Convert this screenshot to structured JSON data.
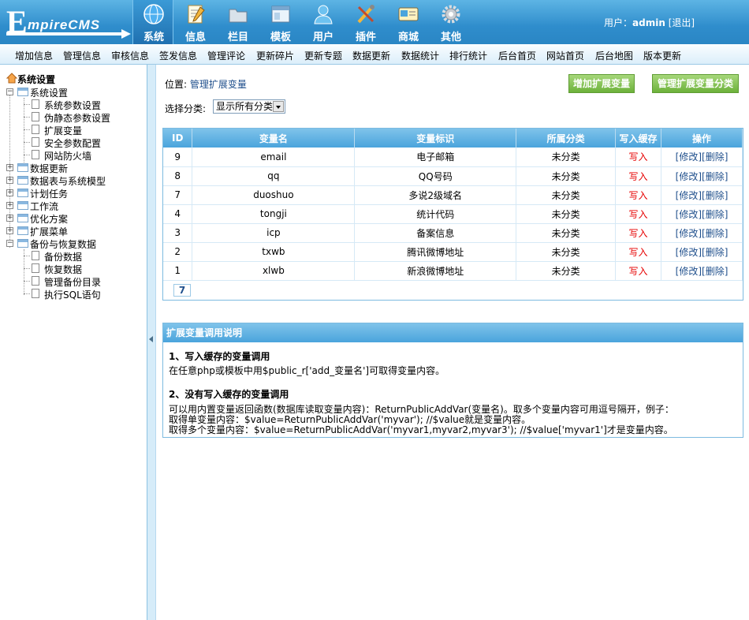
{
  "logo": {
    "big": "E",
    "small": "mpireCMS"
  },
  "main_tabs": [
    {
      "label": "系统",
      "icon": "globe-icon"
    },
    {
      "label": "信息",
      "icon": "notepad-icon"
    },
    {
      "label": "栏目",
      "icon": "folder-icon"
    },
    {
      "label": "模板",
      "icon": "window-icon"
    },
    {
      "label": "用户",
      "icon": "user-icon"
    },
    {
      "label": "插件",
      "icon": "tools-icon"
    },
    {
      "label": "商城",
      "icon": "card-icon"
    },
    {
      "label": "其他",
      "icon": "gear-icon"
    }
  ],
  "user": {
    "prefix": "用户：",
    "name": "admin",
    "logout": "[退出]"
  },
  "subnav": [
    "增加信息",
    "管理信息",
    "审核信息",
    "签发信息",
    "管理评论",
    "更新碎片",
    "更新专题",
    "数据更新",
    "数据统计",
    "排行统计",
    "后台首页",
    "网站首页",
    "后台地图",
    "版本更新"
  ],
  "sidebar": {
    "root": "系统设置",
    "group1": "系统设置",
    "group1_items": [
      "系统参数设置",
      "伪静态参数设置",
      "扩展变量",
      "安全参数配置",
      "网站防火墙"
    ],
    "groups": [
      "数据更新",
      "数据表与系统模型",
      "计划任务",
      "工作流",
      "优化方案",
      "扩展菜单"
    ],
    "group_backup": "备份与恢复数据",
    "backup_items": [
      "备份数据",
      "恢复数据",
      "管理备份目录",
      "执行SQL语句"
    ]
  },
  "location": {
    "prefix": "位置: ",
    "link": "管理扩展变量"
  },
  "buttons": {
    "add": "增加扩展变量",
    "manage": "管理扩展变量分类"
  },
  "filter": {
    "label": "选择分类:",
    "selected": "显示所有分类"
  },
  "table": {
    "headers": [
      "ID",
      "变量名",
      "变量标识",
      "所属分类",
      "写入缓存",
      "操作"
    ],
    "rows": [
      {
        "id": "9",
        "name": "email",
        "label": "电子邮箱",
        "cat": "未分类",
        "cache": "写入",
        "edit": "[修改]",
        "del": "[删除]"
      },
      {
        "id": "8",
        "name": "qq",
        "label": "QQ号码",
        "cat": "未分类",
        "cache": "写入",
        "edit": "[修改]",
        "del": "[删除]"
      },
      {
        "id": "7",
        "name": "duoshuo",
        "label": "多说2级域名",
        "cat": "未分类",
        "cache": "写入",
        "edit": "[修改]",
        "del": "[删除]"
      },
      {
        "id": "4",
        "name": "tongji",
        "label": "统计代码",
        "cat": "未分类",
        "cache": "写入",
        "edit": "[修改]",
        "del": "[删除]"
      },
      {
        "id": "3",
        "name": "icp",
        "label": "备案信息",
        "cat": "未分类",
        "cache": "写入",
        "edit": "[修改]",
        "del": "[删除]"
      },
      {
        "id": "2",
        "name": "txwb",
        "label": "腾讯微博地址",
        "cat": "未分类",
        "cache": "写入",
        "edit": "[修改]",
        "del": "[删除]"
      },
      {
        "id": "1",
        "name": "xlwb",
        "label": "新浪微博地址",
        "cat": "未分类",
        "cache": "写入",
        "edit": "[修改]",
        "del": "[删除]"
      }
    ],
    "pager": "7"
  },
  "help": {
    "title": "扩展变量调用说明",
    "h1": "1、写入缓存的变量调用",
    "p1": "在任意php或模板中用$public_r['add_变量名']可取得变量内容。",
    "h2": "2、没有写入缓存的变量调用",
    "p2a": "可以用内置变量返回函数(数据库读取变量内容)：ReturnPublicAddVar(变量名)。取多个变量内容可用逗号隔开，例子：",
    "p2b": "取得单变量内容：$value=ReturnPublicAddVar('myvar'); //$value就是变量内容。",
    "p2c": "取得多个变量内容：$value=ReturnPublicAddVar('myvar1,myvar2,myvar3'); //$value['myvar1']才是变量内容。"
  },
  "colors": {
    "topbar": "#2f8dcc",
    "button_green": "#6db23b",
    "header_blue": "#4aa4dc",
    "red": "#e60000",
    "link": "#1f4f8c"
  }
}
